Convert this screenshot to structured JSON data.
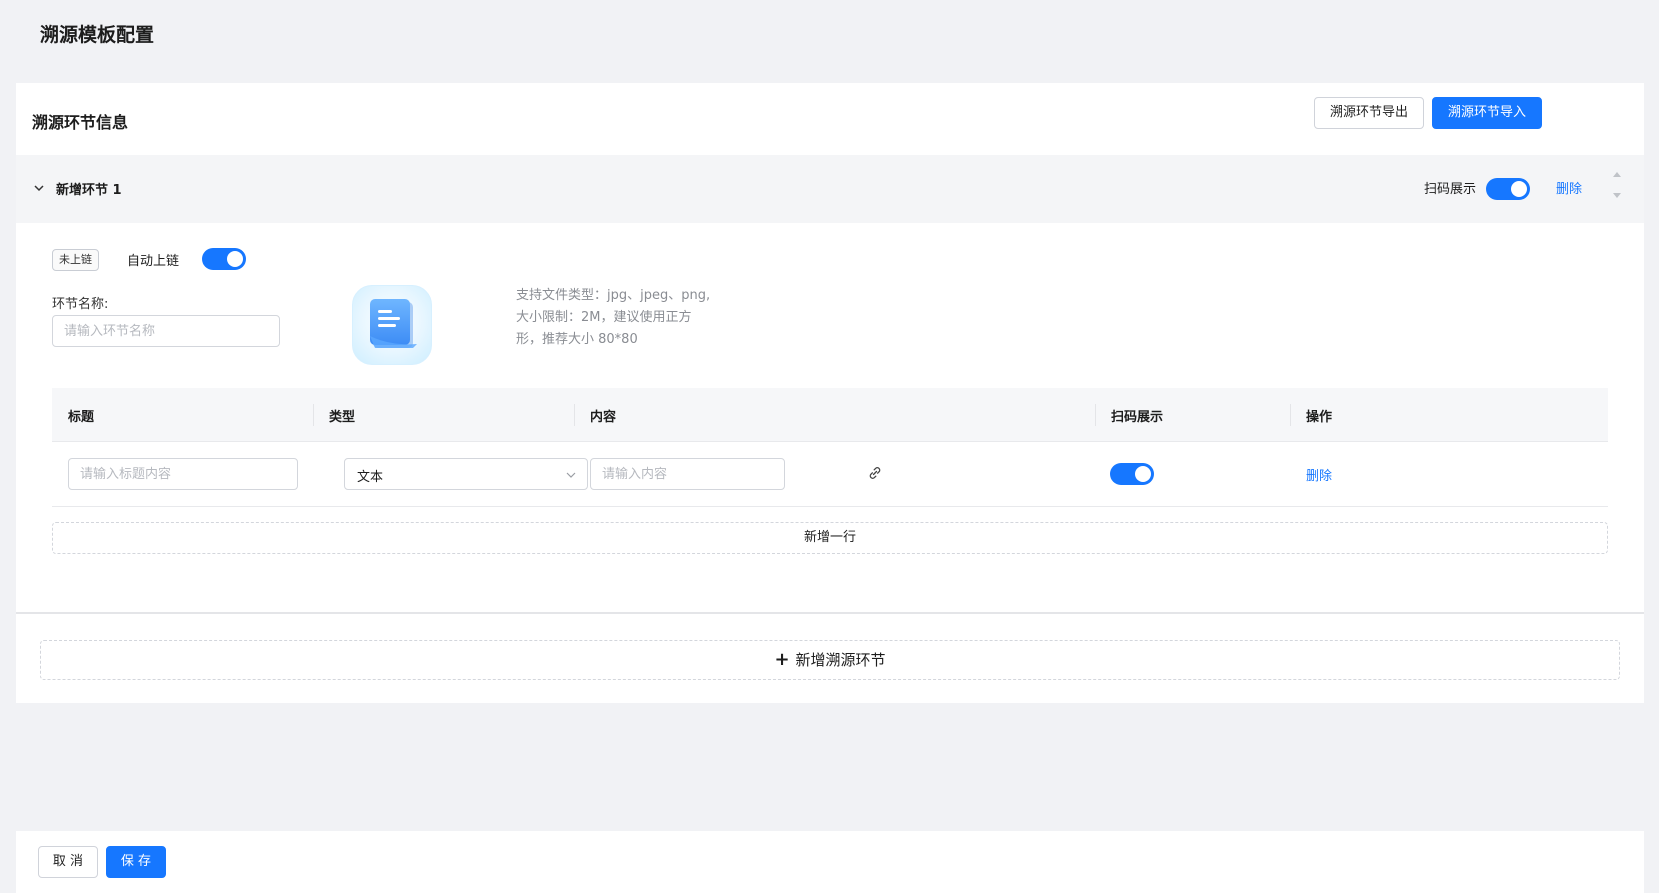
{
  "page": {
    "title": "溯源模板配置"
  },
  "card": {
    "title": "溯源环节信息",
    "export_label": "溯源环节导出",
    "import_label": "溯源环节导入"
  },
  "section": {
    "name": "新增环节 1",
    "scan_display_label": "扫码展示",
    "scan_display_on": true,
    "delete_label": "删除",
    "chain_status_tag": "未上链",
    "auto_chain_label": "自动上链",
    "auto_chain_on": true,
    "name_field": {
      "label": "环节名称:",
      "placeholder": "请输入环节名称",
      "value": ""
    },
    "upload_hint": [
      "支持文件类型：jpg、jpeg、png,",
      "大小限制：2M，建议使用正方",
      "形，推荐大小 80*80"
    ]
  },
  "table": {
    "columns": [
      "标题",
      "类型",
      "内容",
      "扫码展示",
      "操作"
    ],
    "rows": [
      {
        "title_placeholder": "请输入标题内容",
        "type_value": "文本",
        "content_placeholder": "请输入内容",
        "scan_display_on": true,
        "action_label": "删除"
      }
    ],
    "add_row_label": "新增一行"
  },
  "add_section_label": "新增溯源环节",
  "footer": {
    "cancel_label": "取 消",
    "save_label": "保 存"
  },
  "colors": {
    "primary": "#1677ff",
    "background": "#f1f2f5",
    "header_bg": "#f4f5f7"
  },
  "icons": [
    "chevron-down-icon",
    "sort-arrows-icon",
    "document-icon",
    "link-icon",
    "plus-icon"
  ]
}
